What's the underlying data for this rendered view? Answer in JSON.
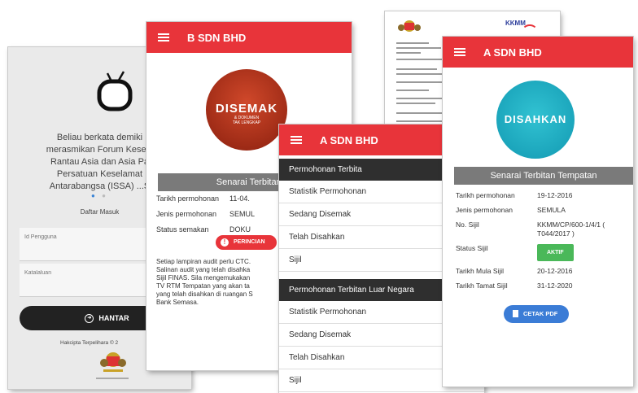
{
  "login": {
    "welcome_text_lines": [
      "Beliau berkata demiki",
      "merasmikan Forum Kesela",
      "Rantau Asia dan Asia Pa",
      "Persatuan Keselamat",
      "Antarabangsa (ISSA) ...S"
    ],
    "register_link": "Daftar Masuk",
    "username_placeholder": "Id Pengguna",
    "password_placeholder": "Katalaluan",
    "submit_label": "HANTAR",
    "copyright": "Hakcipta Terpelihara © 2"
  },
  "b_screen": {
    "title": "B SDN BHD",
    "badge_main": "DISEMAK",
    "badge_sub_lines": [
      "& DOKUMEN",
      "TAK LENGKAP"
    ],
    "section_title": "Senarai Terbitan Te",
    "rows": [
      {
        "label": "Tarikh permohonan",
        "value": "11-04."
      },
      {
        "label": "Jenis permohonan",
        "value": "SEMUL"
      },
      {
        "label": "Status semakan",
        "value": "DOKU LENGK"
      }
    ],
    "details_button": "PERINCIAN",
    "note_lines": [
      "Setiap lampiran audit perlu CTC.",
      "Salinan audit yang telah disahka",
      "Sijil FINAS. Sila mengemukakan",
      "TV RTM Tempatan yang akan ta",
      "yang telah disahkan di ruangan S",
      "Bank Semasa."
    ]
  },
  "document": {
    "logo_text": "KKMM"
  },
  "a_mid": {
    "title": "A SDN BHD",
    "section1_header": "Permohonan Terbita",
    "section1_items": [
      "Statistik Permohonan",
      "Sedang Disemak",
      "Telah Disahkan",
      "Sijil"
    ],
    "section2_header": "Permohonan Terbitan Luar Negara",
    "section2_items": [
      "Statistik Permohonan",
      "Sedang Disemak",
      "Telah Disahkan",
      "Sijil"
    ]
  },
  "a_right": {
    "title": "A SDN BHD",
    "badge_main": "DISAHKAN",
    "section_title": "Senarai Terbitan Tempatan",
    "tarikh_permohonan_label": "Tarikh permohonan",
    "tarikh_permohonan_value": "19-12-2016",
    "jenis_permohonan_label": "Jenis permohonan",
    "jenis_permohonan_value": "SEMULA",
    "no_sijil_label": "No. Sijil",
    "no_sijil_value": "KKMM/CP/600-1/4/1 ( T044/2017 )",
    "status_sijil_label": "Status Sijil",
    "status_sijil_value": "AKTIF",
    "tarikh_mula_label": "Tarikh Mula Sijil",
    "tarikh_mula_value": "20-12-2016",
    "tarikh_tamat_label": "Tarikh Tamat Sijil",
    "tarikh_tamat_value": "31-12-2020",
    "print_button": "CETAK PDF"
  },
  "colors": {
    "appbar_red": "#e8343a",
    "section_gray": "#7a7a7a",
    "active_green": "#4ab859",
    "print_blue": "#3b7cd6",
    "disahkan_teal": "#1fb0c6",
    "disemak_brown": "#b2391e"
  }
}
